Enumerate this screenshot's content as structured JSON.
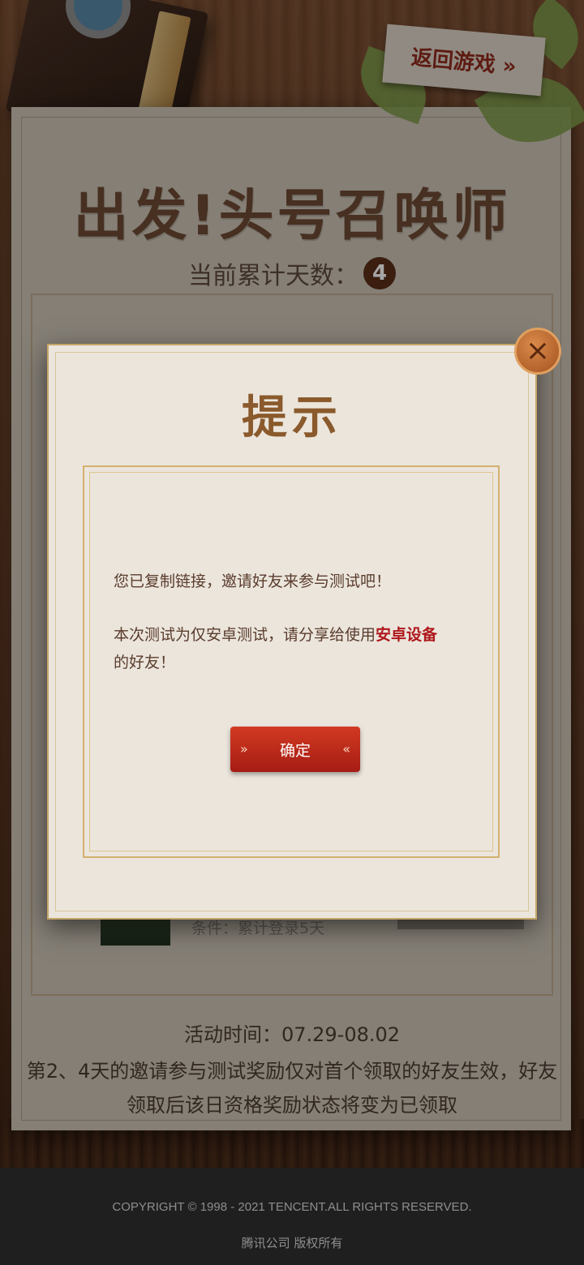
{
  "header": {
    "back_to_game": "返回游戏 »",
    "title": "出发!头号召唤师",
    "days_label": "当前累计天数：",
    "days_value": "4"
  },
  "reward": {
    "condition": "条件：累计登录5天"
  },
  "info": {
    "activity_time": "活动时间：07.29-08.02",
    "rule": "第2、4天的邀请参与测试奖励仅对首个领取的好友生效，好友领取后该日资格奖励状态将变为已领取"
  },
  "modal": {
    "title": "提示",
    "line1": "您已复制链接，邀请好友来参与测试吧！",
    "line2_prefix": "本次测试为仅安卓测试，请分享给使用",
    "line2_highlight": "安卓设备",
    "line2_suffix": "的好友！",
    "confirm": "确定",
    "close_icon": "close-icon"
  },
  "footer": {
    "copyright": "COPYRIGHT © 1998 - 2021 TENCENT.ALL RIGHTS RESERVED.",
    "company": "腾讯公司 版权所有"
  },
  "colors": {
    "accent_red": "#b0181c",
    "button_red": "#d23a22",
    "title_brown": "#8a5a2c"
  }
}
